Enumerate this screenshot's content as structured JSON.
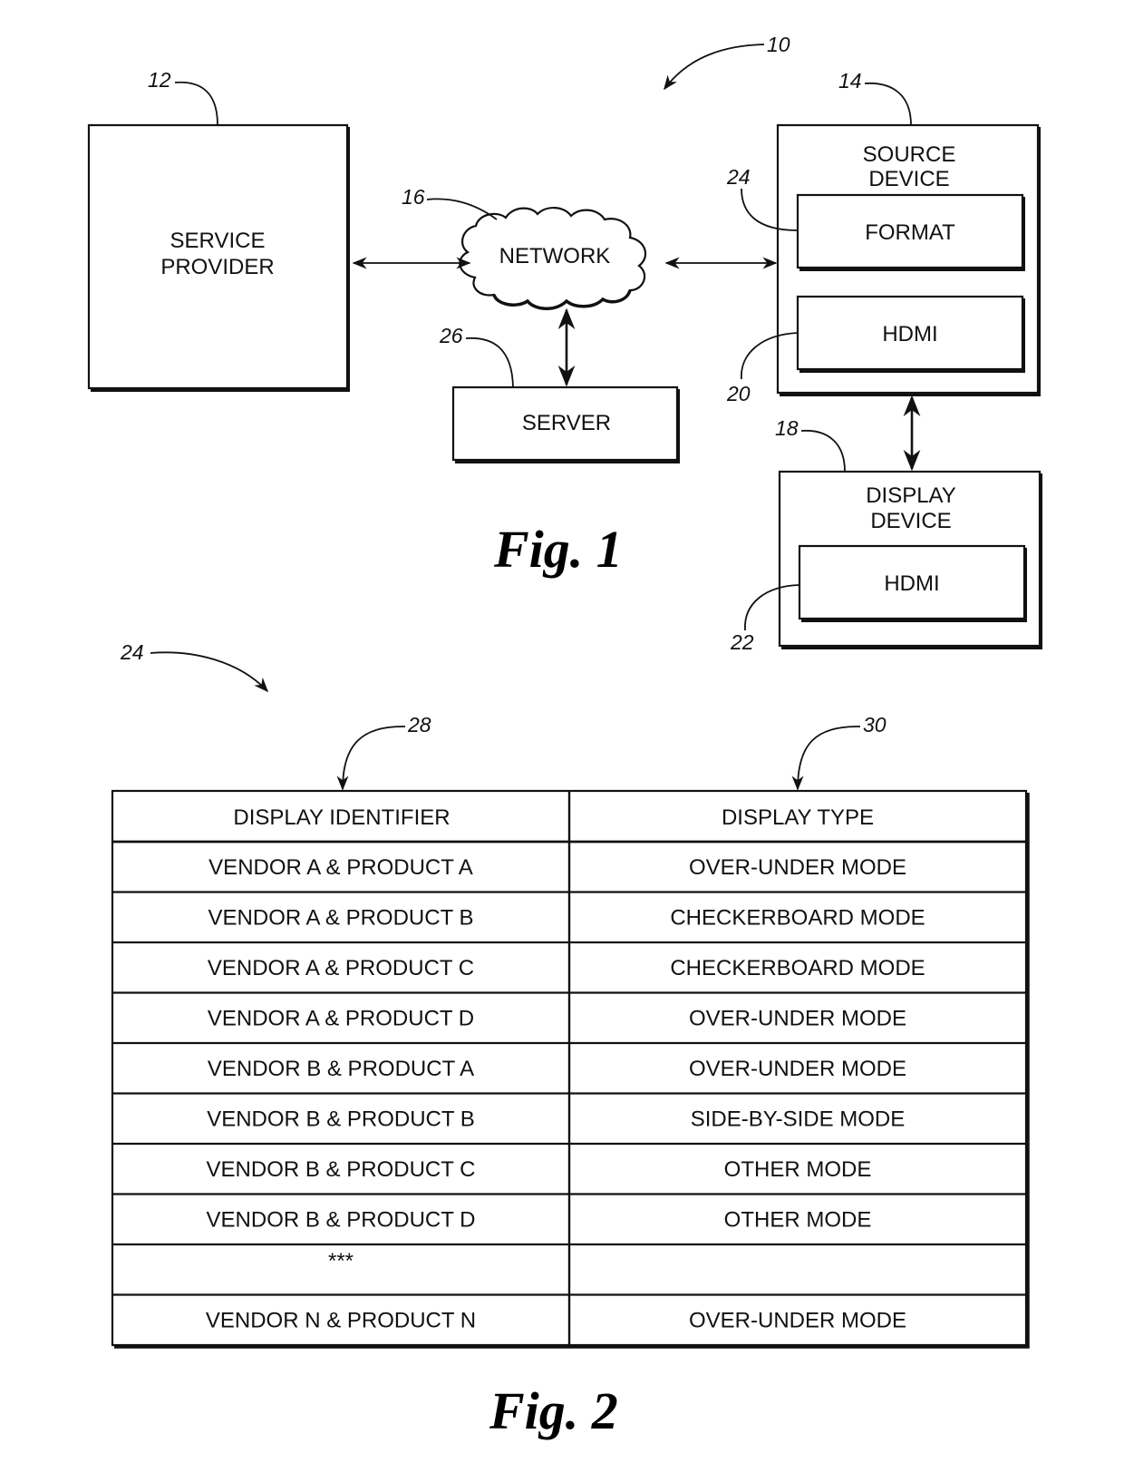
{
  "figure1": {
    "caption": "Fig. 1",
    "system_ref": "10",
    "service_provider": {
      "ref": "12",
      "label_line1": "SERVICE",
      "label_line2": "PROVIDER"
    },
    "network": {
      "ref": "16",
      "label": "NETWORK"
    },
    "server": {
      "ref": "26",
      "label": "SERVER"
    },
    "source_device": {
      "ref": "14",
      "label_line1": "SOURCE",
      "label_line2": "DEVICE",
      "format": {
        "ref": "24",
        "label": "FORMAT"
      },
      "hdmi": {
        "ref": "20",
        "label": "HDMI"
      }
    },
    "display_device": {
      "ref": "18",
      "label_line1": "DISPLAY",
      "label_line2": "DEVICE",
      "hdmi": {
        "ref": "22",
        "label": "HDMI"
      }
    }
  },
  "figure2": {
    "caption": "Fig. 2",
    "table_ref": "24",
    "columns": [
      {
        "ref": "28",
        "header": "DISPLAY IDENTIFIER"
      },
      {
        "ref": "30",
        "header": "DISPLAY TYPE"
      }
    ],
    "rows": [
      [
        "VENDOR A & PRODUCT A",
        "OVER-UNDER MODE"
      ],
      [
        "VENDOR A & PRODUCT B",
        "CHECKERBOARD MODE"
      ],
      [
        "VENDOR A & PRODUCT C",
        "CHECKERBOARD MODE"
      ],
      [
        "VENDOR A & PRODUCT D",
        "OVER-UNDER MODE"
      ],
      [
        "VENDOR B & PRODUCT A",
        "OVER-UNDER MODE"
      ],
      [
        "VENDOR B & PRODUCT B",
        "SIDE-BY-SIDE MODE"
      ],
      [
        "VENDOR B & PRODUCT C",
        "OTHER MODE"
      ],
      [
        "VENDOR B & PRODUCT D",
        "OTHER MODE"
      ],
      [
        "***",
        ""
      ],
      [
        "VENDOR N & PRODUCT N",
        "OVER-UNDER MODE"
      ]
    ]
  }
}
